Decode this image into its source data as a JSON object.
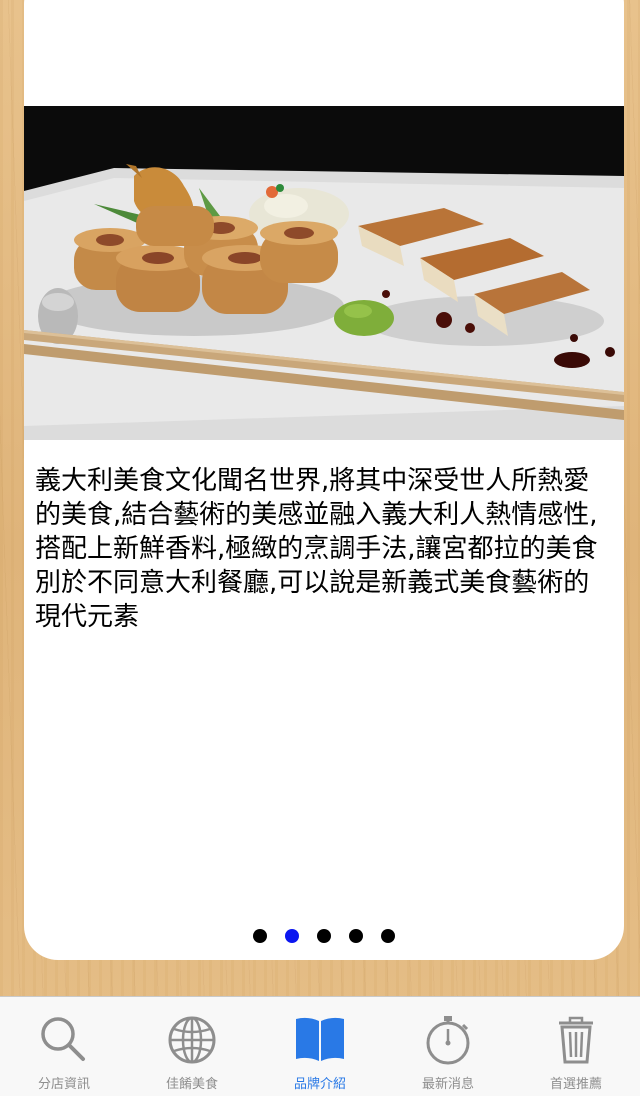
{
  "content": {
    "description": "義大利美食文化聞名世界,將其中深受世人所熱愛的美食,結合藝術的美感並融入義大利人熱情感性,搭配上新鮮香料,極緻的烹調手法,讓宮都拉的美食別於不同意大利餐廳,可以說是新義式美食藝術的現代元素",
    "image_subject": "sushi-rolls-and-grilled-dish-on-white-plate"
  },
  "pager": {
    "count": 5,
    "active_index": 1
  },
  "tabbar": {
    "active_color": "#2979e6",
    "inactive_color": "#8e8e8e",
    "tabs": [
      {
        "label": "分店資訊",
        "icon": "search-icon"
      },
      {
        "label": "佳餚美食",
        "icon": "globe-icon"
      },
      {
        "label": "品牌介紹",
        "icon": "open-book-icon"
      },
      {
        "label": "最新消息",
        "icon": "stopwatch-icon"
      },
      {
        "label": "首選推薦",
        "icon": "trash-icon"
      }
    ]
  }
}
